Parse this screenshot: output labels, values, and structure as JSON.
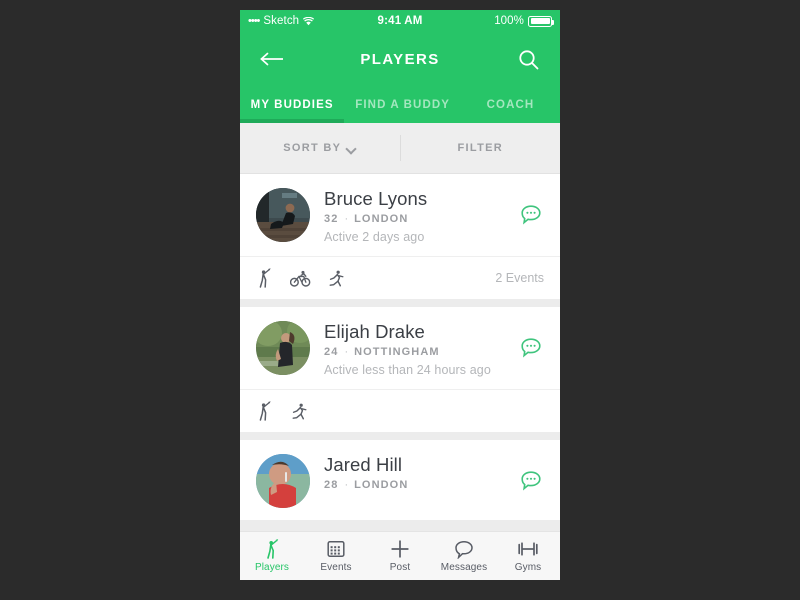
{
  "theme": {
    "brand_green": "#27c568",
    "tab_underline": "#1faa59",
    "bar_gray": "#eeeeee",
    "muted_text": "#9b9da1",
    "name_text": "#3b3f45",
    "icon_dark": "#585c65"
  },
  "status_bar": {
    "signal_dots": "••••",
    "carrier": "Sketch",
    "wifi_icon": "wifi-icon",
    "time": "9:41 AM",
    "battery_percent": "100%",
    "battery_icon": "battery-full-icon"
  },
  "navbar": {
    "back_icon": "arrow-left-icon",
    "title": "PLAYERS",
    "search_icon": "search-icon"
  },
  "tabs": [
    {
      "label": "MY BUDDIES",
      "active": true
    },
    {
      "label": "FIND A BUDDY",
      "active": false
    },
    {
      "label": "COACH",
      "active": false
    }
  ],
  "filter_bar": {
    "sort_label": "SORT BY",
    "sort_chevron_icon": "chevron-down-icon",
    "filter_label": "FILTER"
  },
  "players": [
    {
      "name": "Bruce Lyons",
      "age": "32",
      "separator": "·",
      "city": "LONDON",
      "active": "Active 2 days ago",
      "avatar_icon": "avatar-photo-bruce",
      "chat_icon": "chat-bubble-icon",
      "sports": [
        "golf-icon",
        "cycling-icon",
        "running-icon"
      ],
      "events": "2 Events"
    },
    {
      "name": "Elijah Drake",
      "age": "24",
      "separator": "·",
      "city": "NOTTINGHAM",
      "active": "Active less than 24 hours ago",
      "avatar_icon": "avatar-photo-elijah",
      "chat_icon": "chat-bubble-icon",
      "sports": [
        "golf-icon",
        "running-icon"
      ],
      "events": ""
    },
    {
      "name": "Jared Hill",
      "age": "28",
      "separator": "·",
      "city": "LONDON",
      "active": "",
      "avatar_icon": "avatar-photo-jared",
      "chat_icon": "chat-bubble-icon",
      "sports": [],
      "events": ""
    }
  ],
  "bottom_nav": [
    {
      "label": "Players",
      "icon": "golfer-icon",
      "active": true
    },
    {
      "label": "Events",
      "icon": "calendar-icon",
      "active": false
    },
    {
      "label": "Post",
      "icon": "plus-icon",
      "active": false
    },
    {
      "label": "Messages",
      "icon": "chat-bubble-icon",
      "active": false
    },
    {
      "label": "Gyms",
      "icon": "dumbbell-icon",
      "active": false
    }
  ]
}
